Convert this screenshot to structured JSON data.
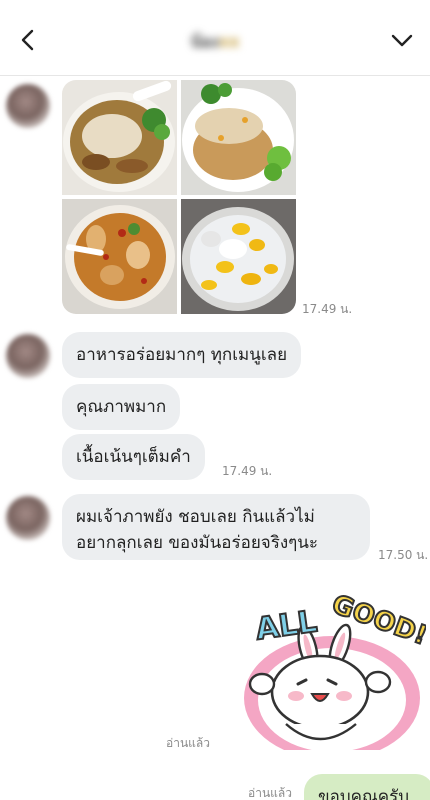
{
  "header": {
    "title": "น้อง",
    "title_accent": "xx",
    "back_icon": "chevron-left-icon",
    "menu_icon": "chevron-down-icon"
  },
  "messages": {
    "photo_time": "17.49 น.",
    "group2": {
      "bubble1": "อาหารอร่อยมากๆ ทุกเมนูเลย",
      "bubble2": "คุณภาพมาก",
      "bubble3": "เนื้อเน้นๆเต็มคำ",
      "time": "17.49 น."
    },
    "group3": {
      "line1": "ผมเจ้าภาพยัง ชอบเลย กินแล้วไม่",
      "line2": "อยากลุกเลย ของมันอร่อยจริงๆนะ",
      "time": "17.50 น."
    },
    "sticker": {
      "text": "ALL GOOD!",
      "read": "อ่านแล้ว"
    },
    "sent": {
      "text": "ขอบคุณครับ",
      "read": "อ่านแล้ว"
    }
  },
  "colors": {
    "received_bubble": "#eceef0",
    "sent_bubble": "#d6ecc4",
    "sticker_ring": "#f4a6c4",
    "sticker_text": "#7fd0e8"
  }
}
